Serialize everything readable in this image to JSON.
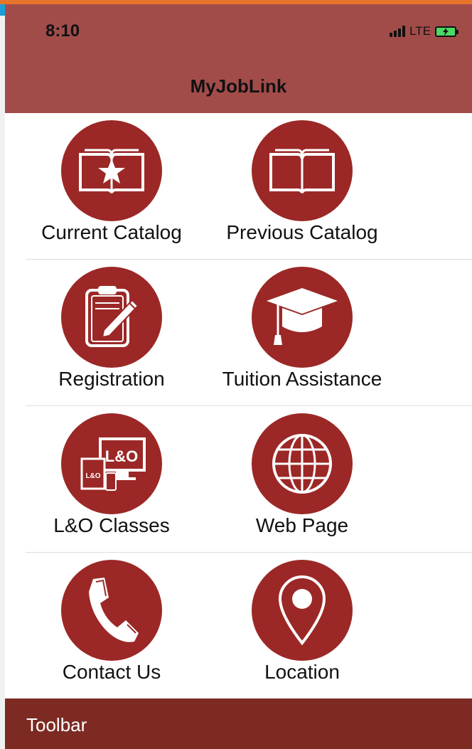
{
  "status_bar": {
    "time": "8:10",
    "network": "LTE"
  },
  "header": {
    "title": "MyJobLink"
  },
  "grid": {
    "items": [
      {
        "label": "Current Catalog",
        "icon": "book-star-icon"
      },
      {
        "label": "Previous Catalog",
        "icon": "open-book-icon"
      },
      {
        "label": "Registration",
        "icon": "clipboard-pencil-icon"
      },
      {
        "label": "Tuition Assistance",
        "icon": "graduation-cap-icon"
      },
      {
        "label": "L&O Classes",
        "icon": "devices-icon",
        "icon_text": "L&O"
      },
      {
        "label": "Web Page",
        "icon": "globe-icon"
      },
      {
        "label": "Contact Us",
        "icon": "phone-icon"
      },
      {
        "label": "Location",
        "icon": "map-pin-icon"
      }
    ]
  },
  "toolbar": {
    "label": "Toolbar"
  },
  "colors": {
    "header": "#a24c4a",
    "icon_circle": "#9b2826",
    "toolbar": "#7d2a23",
    "accent_orange": "#e8732a",
    "accent_blue": "#1b9ed6"
  }
}
